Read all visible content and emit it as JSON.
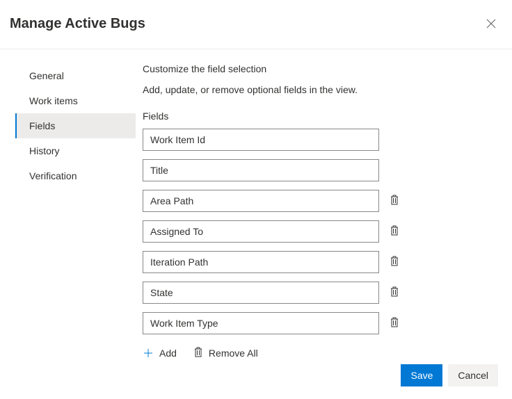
{
  "header": {
    "title": "Manage Active Bugs"
  },
  "sidebar": {
    "items": [
      {
        "label": "General",
        "key": "general"
      },
      {
        "label": "Work items",
        "key": "work-items"
      },
      {
        "label": "Fields",
        "key": "fields"
      },
      {
        "label": "History",
        "key": "history"
      },
      {
        "label": "Verification",
        "key": "verification"
      }
    ],
    "active_index": 2
  },
  "content": {
    "title": "Customize the field selection",
    "description": "Add, update, or remove optional fields in the view.",
    "fields_label": "Fields",
    "fields": [
      {
        "value": "Work Item Id",
        "removable": false
      },
      {
        "value": "Title",
        "removable": false
      },
      {
        "value": "Area Path",
        "removable": true
      },
      {
        "value": "Assigned To",
        "removable": true
      },
      {
        "value": "Iteration Path",
        "removable": true
      },
      {
        "value": "State",
        "removable": true
      },
      {
        "value": "Work Item Type",
        "removable": true
      }
    ],
    "add_label": "Add",
    "remove_all_label": "Remove All"
  },
  "footer": {
    "save_label": "Save",
    "cancel_label": "Cancel"
  }
}
